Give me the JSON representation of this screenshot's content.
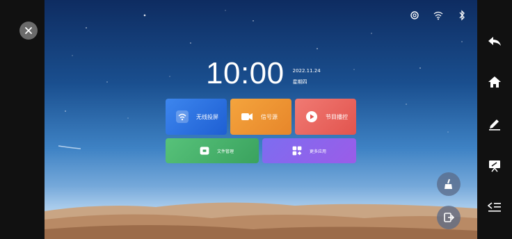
{
  "clock": {
    "time": "10:00",
    "date": "2022.11.24",
    "weekday": "星期四"
  },
  "tiles": [
    {
      "label": "无线投屏",
      "icon": "wifi-cast-icon"
    },
    {
      "label": "信号源",
      "icon": "camera-icon"
    },
    {
      "label": "节目播控",
      "icon": "play-icon"
    },
    {
      "label": "文件管理",
      "icon": "folder-icon"
    },
    {
      "label": "更多应用",
      "icon": "apps-grid-icon"
    }
  ],
  "status_icons": [
    "gear-icon",
    "wifi-icon",
    "bluetooth-icon"
  ],
  "right_nav_icons": [
    "back-icon",
    "home-icon",
    "pen-icon",
    "whiteboard-icon",
    "collapse-menu-icon"
  ],
  "floating_icons": [
    "broom-icon",
    "exit-icon"
  ],
  "colors": {
    "tile_blue": "#2f72e3",
    "tile_orange": "#ef9634",
    "tile_red": "#ea6862",
    "tile_green": "#48b26b",
    "tile_purple": "#8c65ec"
  }
}
